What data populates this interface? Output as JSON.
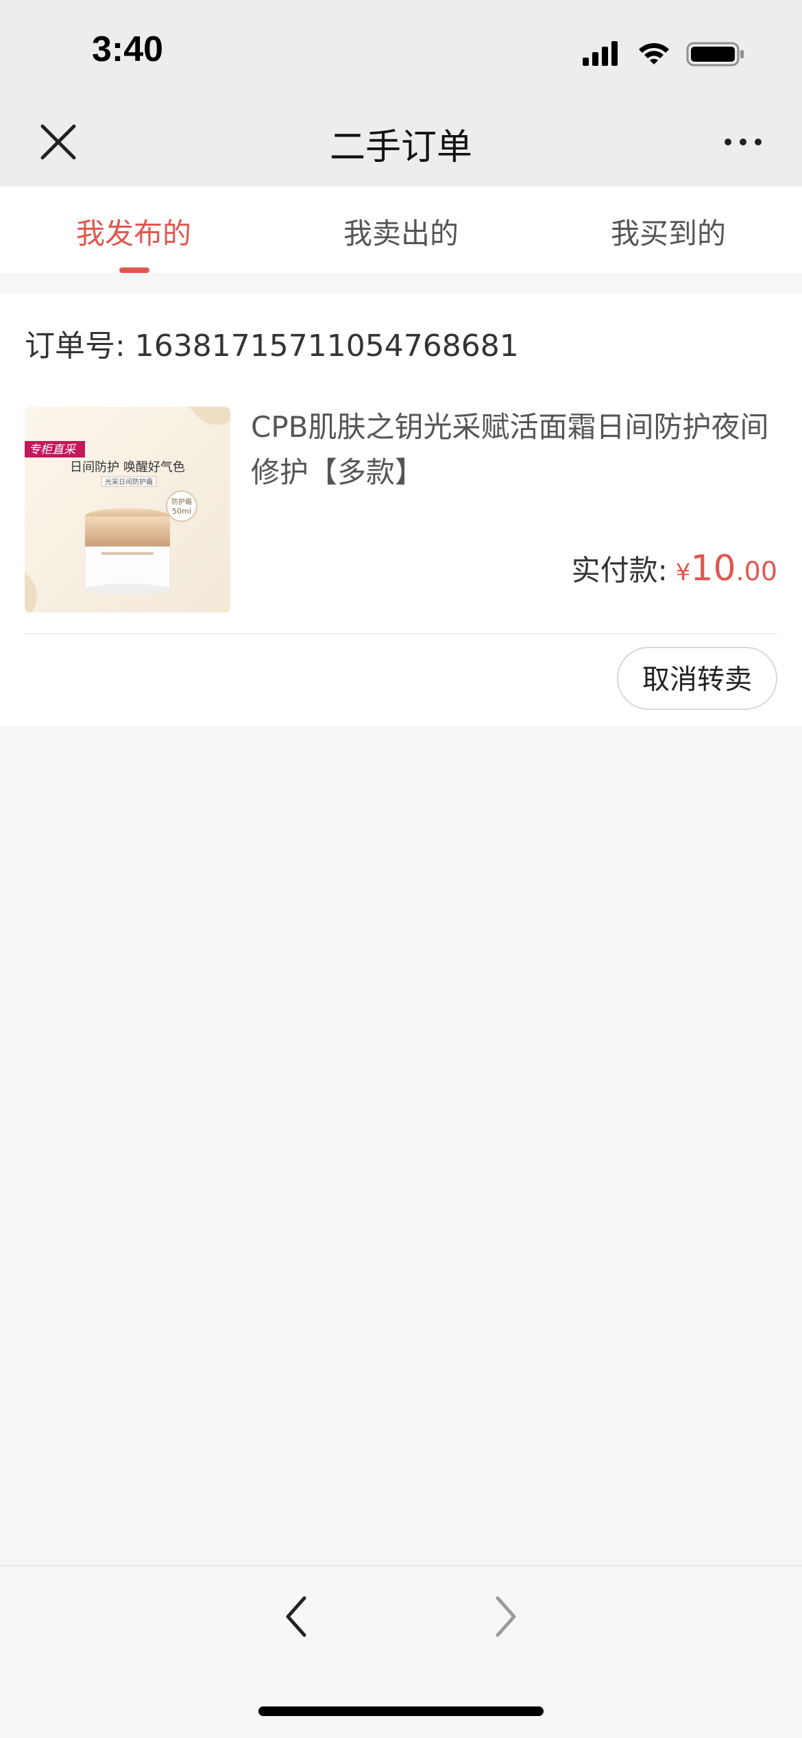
{
  "status_bar": {
    "time": "3:40",
    "icons": [
      "signal-icon",
      "wifi-icon",
      "battery-icon"
    ]
  },
  "nav": {
    "title": "二手订单",
    "close_icon": "close-icon",
    "more_icon": "more-icon"
  },
  "tabs": [
    {
      "label": "我发布的",
      "active": true
    },
    {
      "label": "我卖出的",
      "active": false
    },
    {
      "label": "我买到的",
      "active": false
    }
  ],
  "order": {
    "order_no_label": "订单号: 16381715711054768681",
    "product_title": "CPB肌肤之钥光采赋活面霜日间防护夜间修护【多款】",
    "product_image": {
      "badge": "专柜直采",
      "headline": "日间防护 唤醒好气色",
      "subline": "光采日间防护霜",
      "tag_line1": "防护霜",
      "tag_line2": "50ml"
    },
    "paid_label": "实付款:",
    "currency": "¥",
    "price_integer": "10",
    "price_decimal": ".00",
    "cancel_button": "取消转卖"
  },
  "bottom_nav": {
    "back_icon": "chevron-left-icon",
    "forward_icon": "chevron-right-icon"
  },
  "colors": {
    "accent": "#e0574f",
    "nav_bg": "#ededed",
    "page_bg": "#f6f6f6"
  }
}
